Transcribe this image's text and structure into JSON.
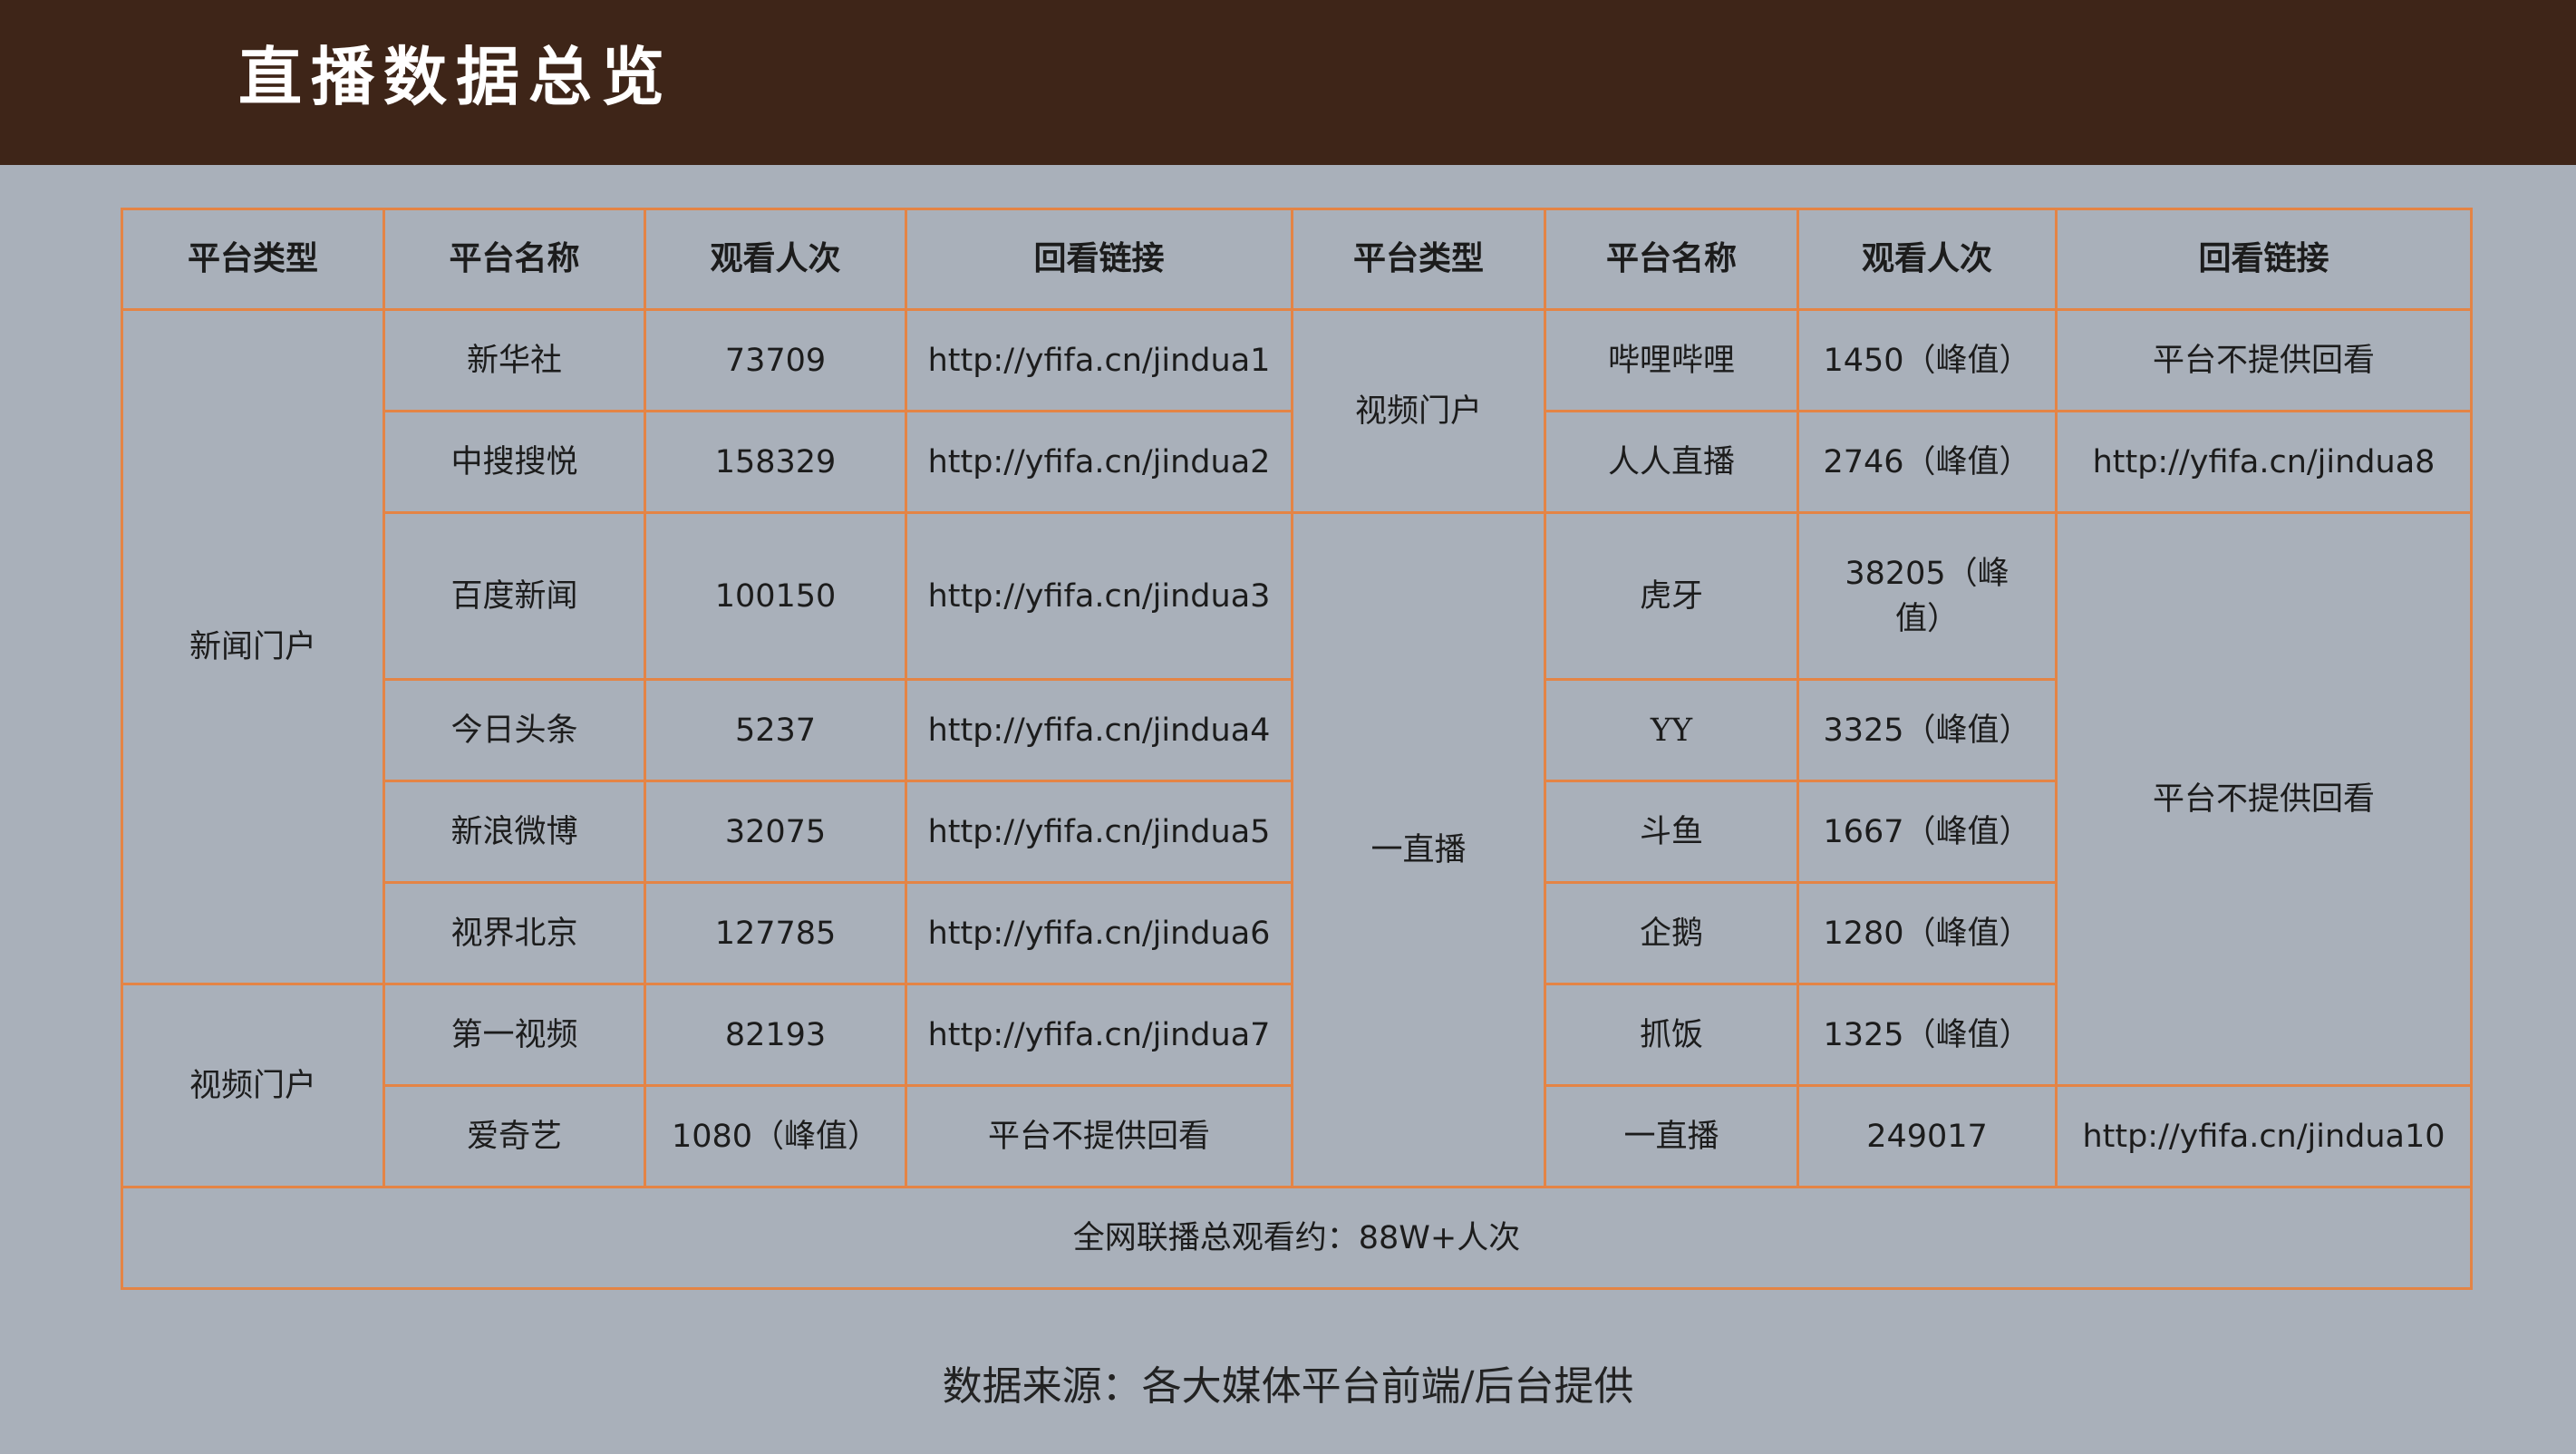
{
  "title": "直播数据总览",
  "headers": [
    "平台类型",
    "平台名称",
    "观看人次",
    "回看链接",
    "平台类型",
    "平台名称",
    "观看人次",
    "回看链接"
  ],
  "left": {
    "groups": [
      {
        "type": "新闻门户",
        "rows": [
          {
            "name": "新华社",
            "views": "73709",
            "link": "http://yfifa.cn/jindua1"
          },
          {
            "name": "中搜搜悦",
            "views": "158329",
            "link": "http://yfifa.cn/jindua2"
          },
          {
            "name": "百度新闻",
            "views": "100150",
            "link": "http://yfifa.cn/jindua3"
          },
          {
            "name": "今日头条",
            "views": "5237",
            "link": "http://yfifa.cn/jindua4"
          },
          {
            "name": "新浪微博",
            "views": "32075",
            "link": "http://yfifa.cn/jindua5"
          },
          {
            "name": "视界北京",
            "views": "127785",
            "link": "http://yfifa.cn/jindua6"
          }
        ]
      },
      {
        "type": "视频门户",
        "rows": [
          {
            "name": "第一视频",
            "views": "82193",
            "link": "http://yfifa.cn/jindua7"
          },
          {
            "name": "爱奇艺",
            "views": "1080（峰值）",
            "link": "平台不提供回看"
          }
        ]
      }
    ]
  },
  "right": {
    "types": [
      "视频门户",
      "一直播"
    ],
    "rows": [
      {
        "name": "哔哩哔哩",
        "views": "1450（峰值）"
      },
      {
        "name": "人人直播",
        "views": "2746（峰值）"
      },
      {
        "name": "虎牙",
        "views": "38205（峰值）"
      },
      {
        "name": "YY",
        "views": "3325（峰值）"
      },
      {
        "name": "斗鱼",
        "views": "1667（峰值）"
      },
      {
        "name": "企鹅",
        "views": "1280（峰值）"
      },
      {
        "name": "抓饭",
        "views": "1325（峰值）"
      },
      {
        "name": "一直播",
        "views": "249017"
      }
    ],
    "links": {
      "row1": "平台不提供回看",
      "row2": "http://yfifa.cn/jindua8",
      "rows3to7": "平台不提供回看",
      "row8": "http://yfifa.cn/jindua10"
    }
  },
  "total": "全网联播总观看约：88W+人次",
  "source": "数据来源：各大媒体平台前端/后台提供"
}
